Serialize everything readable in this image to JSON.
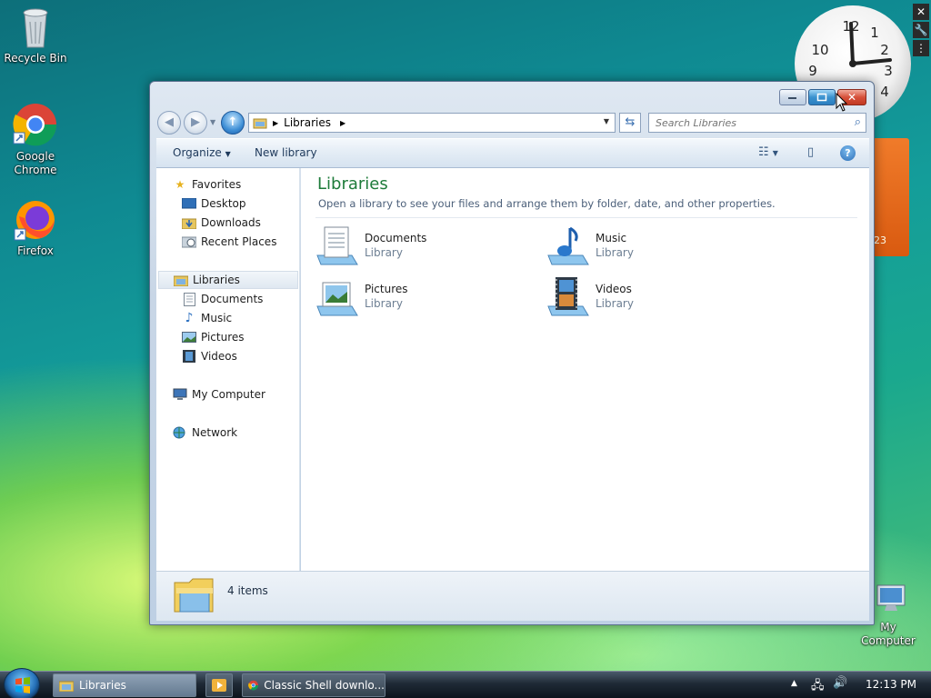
{
  "desktop": {
    "icons": [
      {
        "label": "Recycle Bin"
      },
      {
        "label": "Google\nChrome"
      },
      {
        "label": "Firefox"
      },
      {
        "label": "My Computer"
      }
    ],
    "calendar_text": "23"
  },
  "window": {
    "address": {
      "crumb": "Libraries"
    },
    "search": {
      "placeholder": "Search Libraries"
    },
    "toolbar": {
      "organize": "Organize",
      "new_library": "New library"
    },
    "nav": {
      "favorites": "Favorites",
      "desktop": "Desktop",
      "downloads": "Downloads",
      "recent_places": "Recent Places",
      "libraries": "Libraries",
      "documents": "Documents",
      "music": "Music",
      "pictures": "Pictures",
      "videos": "Videos",
      "my_computer": "My Computer",
      "network": "Network"
    },
    "content": {
      "title": "Libraries",
      "subtitle": "Open a library to see your files and arrange them by folder, date, and other properties.",
      "items": [
        {
          "name": "Documents",
          "type": "Library"
        },
        {
          "name": "Music",
          "type": "Library"
        },
        {
          "name": "Pictures",
          "type": "Library"
        },
        {
          "name": "Videos",
          "type": "Library"
        }
      ]
    },
    "details": {
      "count": "4 items"
    }
  },
  "taskbar": {
    "tasks": [
      {
        "label": "Libraries"
      },
      {
        "label": "Classic Shell downlo..."
      }
    ],
    "clock": "12:13 PM"
  },
  "colors": {
    "title_green": "#1e7b3a",
    "close_red": "#c23a22",
    "accent_blue": "#2a7ec0"
  }
}
